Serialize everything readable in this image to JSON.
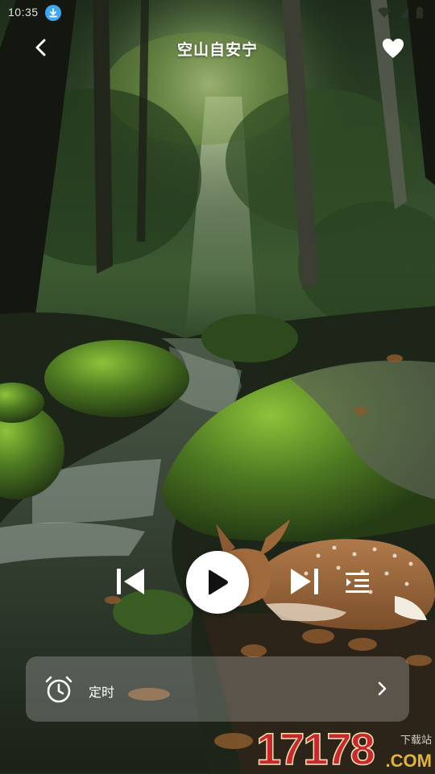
{
  "status_bar": {
    "time": "10:35",
    "download_icon": "download-arrow-icon",
    "wifi_icon": "wifi-icon",
    "signal_icon": "signal-icon",
    "battery_icon": "battery-icon"
  },
  "header": {
    "title": "空山自安宁",
    "back_icon": "chevron-left-icon",
    "favorite_icon": "heart-icon"
  },
  "player": {
    "prev_icon": "skip-previous-icon",
    "play_icon": "play-icon",
    "next_icon": "skip-next-icon",
    "playlist_icon": "playlist-icon"
  },
  "timer": {
    "label": "定时",
    "icon": "alarm-clock-icon",
    "chevron_icon": "chevron-right-icon"
  },
  "watermark": {
    "number": "17178",
    "site": "下载站",
    "domain": ".COM"
  },
  "colors": {
    "accent_blue": "#3ea6f2",
    "timer_bg": "rgba(255,255,255,0.22)",
    "watermark_red": "#c8282e",
    "watermark_gold": "#e0b43a"
  }
}
